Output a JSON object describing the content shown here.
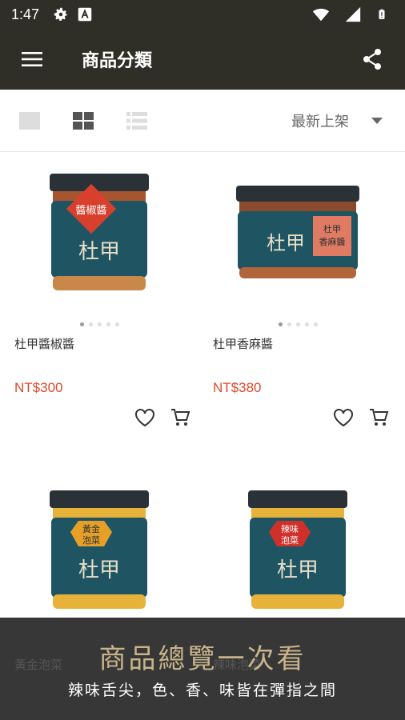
{
  "status_bar": {
    "time": "1:47",
    "icons": [
      "settings-icon",
      "a-icon",
      "wifi-icon",
      "signal-icon",
      "battery-icon"
    ]
  },
  "app_bar": {
    "title": "商品分類",
    "menu_icon": "hamburger-icon",
    "share_icon": "share-icon"
  },
  "toolbar": {
    "view_modes": [
      "single-view-icon",
      "grid-view-icon",
      "list-view-icon"
    ],
    "active_view": "grid",
    "sort_label": "最新上架"
  },
  "products": [
    {
      "name": "杜甲醬椒醬",
      "price": "NT$300",
      "lid_color": "#2a3137",
      "label_color": "#d8402d",
      "jar_color": "#1f5563",
      "fill_color": "#a7552f",
      "label_text": "杜甲 醬椒醬"
    },
    {
      "name": "杜甲香麻醬",
      "price": "NT$380",
      "lid_color": "#2a3137",
      "label_color": "#e07a63",
      "jar_color": "#1f5563",
      "fill_color": "#8b4a2d",
      "label_text": "杜甲 香麻醬"
    },
    {
      "name": "黃金泡菜",
      "price": "",
      "lid_color": "#2a3137",
      "label_color": "#e6a027",
      "jar_color": "#1f5563",
      "fill_color": "#e7b23a",
      "label_text": "黃金 泡菜"
    },
    {
      "name": "辣味泡菜",
      "price": "",
      "lid_color": "#2a3137",
      "label_color": "#d0302a",
      "jar_color": "#1f5563",
      "fill_color": "#e7b23a",
      "label_text": "辣味 泡菜"
    }
  ],
  "jar_brand_text": "杜甲",
  "promo": {
    "headline": "商品總覽一次看",
    "subline": "辣味舌尖，色、香、味皆在彈指之間",
    "ghost_left": "黃金泡菜",
    "ghost_right": "辣味泡菜"
  },
  "colors": {
    "appbar": "#2f2f27",
    "price": "#e0482a",
    "promo_gold": "#c9b48a"
  }
}
